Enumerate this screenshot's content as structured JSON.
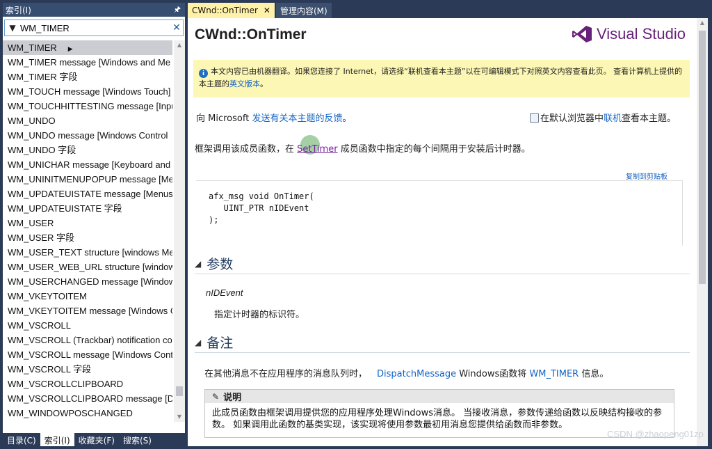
{
  "index_panel": {
    "title": "索引(I)",
    "pin_icon": "pin-icon",
    "search_value": "WM_TIMER",
    "items": [
      "WM_TIMER",
      "WM_TIMER message [Windows and Me",
      "WM_TIMER 字段",
      "WM_TOUCH message [Windows Touch]",
      "WM_TOUCHHITTESTING message [Inpu",
      "WM_UNDO",
      "WM_UNDO message [Windows Control",
      "WM_UNDO 字段",
      "WM_UNICHAR message [Keyboard and",
      "WM_UNINITMENUPOPUP message [Me",
      "WM_UPDATEUISTATE message [Menus",
      "WM_UPDATEUISTATE 字段",
      "WM_USER",
      "WM_USER 字段",
      "WM_USER_TEXT structure [windows Me",
      "WM_USER_WEB_URL structure [windows",
      "WM_USERCHANGED message [Window",
      "WM_VKEYTOITEM",
      "WM_VKEYTOITEM message [Windows C",
      "WM_VSCROLL",
      "WM_VSCROLL (Trackbar) notification co",
      "WM_VSCROLL message [Windows Contr",
      "WM_VSCROLL 字段",
      "WM_VSCROLLCLIPBOARD",
      "WM_VSCROLLCLIPBOARD message [Dat",
      "WM_WINDOWPOSCHANGED"
    ],
    "bottom_tabs": [
      "目录(C)",
      "索引(I)",
      "收藏夹(F)",
      "搜索(S)"
    ]
  },
  "doc_tabs": {
    "active": "CWnd::OnTimer",
    "inactive": "管理内容(M)"
  },
  "doc": {
    "title": "CWnd::OnTimer",
    "logo_text": "Visual Studio",
    "notice_text": "本文内容已由机器翻译。如果您连接了 Internet，请选择“联机查看本主题”以在可编辑模式下对照英文内容查看此页。 查看计算机上提供的本主题的",
    "notice_link": "英文版本",
    "notice_end": "。",
    "feedback_prefix": "向 Microsoft ",
    "feedback_link": "发送有关本主题的反馈",
    "feedback_end": "。",
    "browser_prefix": "在默认浏览器中",
    "browser_link": "联机",
    "browser_suffix": "查看本主题。",
    "desc_prefix": "框架调用该成员函数，在 ",
    "desc_link": "SetTimer",
    "desc_suffix": " 成员函数中指定的每个间隔用于安装后计时器。",
    "copy_label": "复制到剪贴板",
    "code": "afx_msg void OnTimer(\n   UINT_PTR nIDEvent\n);",
    "params_title": "参数",
    "param_name": "nIDEvent",
    "param_desc": "指定计时器的标识符。",
    "remarks_title": "备注",
    "remark_prefix": "在其他消息不在应用程序的消息队列时，",
    "remark_link1": "DispatchMessage",
    "remark_mid": " Windows函数将 ",
    "remark_link2": "WM_TIMER",
    "remark_end": " 信息。",
    "note_title": "说明",
    "note_body": "此成员函数由框架调用提供您的应用程序处理Windows消息。 当接收消息，参数传递给函数以反映结构接收的参数。 如果调用此函数的基类实现，该实现将使用参数最初用消息您提供给函数而非参数。"
  },
  "watermark": "CSDN @zhaopeng01zp",
  "colors": {
    "chrome": "#2b3a57",
    "active_tab": "#fff2a8",
    "notice_bg": "#fdf7b5",
    "link": "#1364c4",
    "vs_purple": "#68217a"
  }
}
